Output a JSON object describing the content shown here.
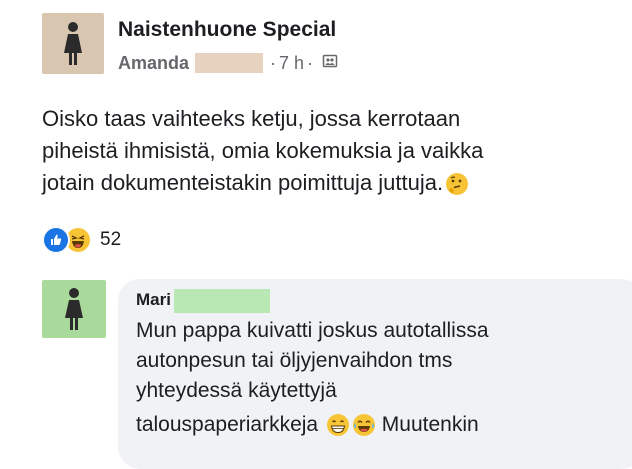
{
  "post": {
    "group_name": "Naistenhuone Special",
    "author": "Amanda",
    "time": "7 h",
    "separator": "·",
    "body_lines": [
      "Oisko taas vaihteeks ketju, jossa kerrotaan",
      "piheistä ihmisistä, omia kokemuksia ja vaikka",
      "jotain dokumenteistakin poimittuja juttuja."
    ],
    "body_emoji": "thinking-face",
    "reactions": {
      "types": [
        "like",
        "haha"
      ],
      "count": "52"
    }
  },
  "comment": {
    "author": "Mari",
    "lines": [
      "Mun pappa kuivatti joskus autotallissa",
      "autonpesun tai öljyjenvaihdon tms",
      "yhteydessä käytettyjä"
    ],
    "last_line_start": "talouspaperiarkkeja",
    "last_line_end": "Muutenkin",
    "emojis": [
      "grinning-face",
      "tears-of-joy-face"
    ]
  },
  "colors": {
    "group_avatar": "#d9c6b0",
    "comment_avatar": "#a9d99b",
    "bubble": "#f0f2f5",
    "like_blue": "#1b74e4",
    "haha_yellow": "#f7c436"
  }
}
